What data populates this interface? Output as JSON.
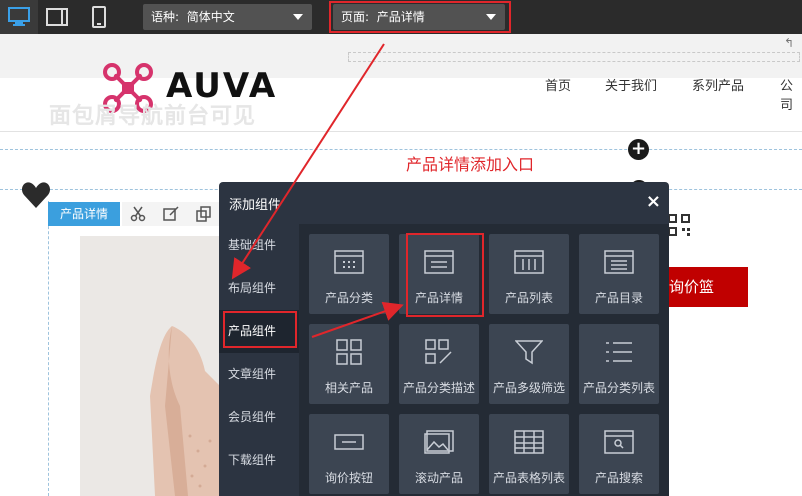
{
  "toolbar": {
    "devices": [
      "desktop-icon",
      "tablet-icon",
      "mobile-icon"
    ],
    "language_label": "语种:",
    "language_value": "简体中文",
    "page_label": "页面:",
    "page_value": "产品详情"
  },
  "site": {
    "logo_text": "AUVA",
    "nav": [
      "首页",
      "关于我们",
      "系列产品",
      "公司"
    ],
    "ghost_breadcrumb": "面包屑导航前台可见",
    "inquiry_button": "询价篮"
  },
  "annotation": {
    "text": "产品详情添加入口"
  },
  "module": {
    "tag": "产品详情"
  },
  "dialog": {
    "title": "添加组件",
    "close": "×",
    "categories": [
      {
        "label": "基础组件",
        "active": false
      },
      {
        "label": "布局组件",
        "active": false
      },
      {
        "label": "产品组件",
        "active": true
      },
      {
        "label": "文章组件",
        "active": false
      },
      {
        "label": "会员组件",
        "active": false
      },
      {
        "label": "下载组件",
        "active": false
      }
    ],
    "components": [
      {
        "label": "产品分类",
        "icon": "category-panel-icon"
      },
      {
        "label": "产品详情",
        "icon": "detail-panel-icon"
      },
      {
        "label": "产品列表",
        "icon": "list-columns-icon"
      },
      {
        "label": "产品目录",
        "icon": "catalog-icon"
      },
      {
        "label": "相关产品",
        "icon": "four-squares-icon"
      },
      {
        "label": "产品分类描述",
        "icon": "squares-pencil-icon"
      },
      {
        "label": "产品多级筛选",
        "icon": "filter-funnel-icon"
      },
      {
        "label": "产品分类列表",
        "icon": "bullet-list-icon"
      },
      {
        "label": "询价按钮",
        "icon": "button-icon"
      },
      {
        "label": "滚动产品",
        "icon": "image-slider-icon"
      },
      {
        "label": "产品表格列表",
        "icon": "table-icon"
      },
      {
        "label": "产品搜索",
        "icon": "search-box-icon"
      }
    ]
  },
  "colors": {
    "toolbar_bg": "#2b2b2b",
    "dialog_bg": "#2c3441",
    "cell_bg": "#3c4552",
    "annotation_red": "#e0262b",
    "module_blue": "#3b9fde",
    "inquiry_red": "#c00000",
    "logo_pink": "#d6336c"
  }
}
